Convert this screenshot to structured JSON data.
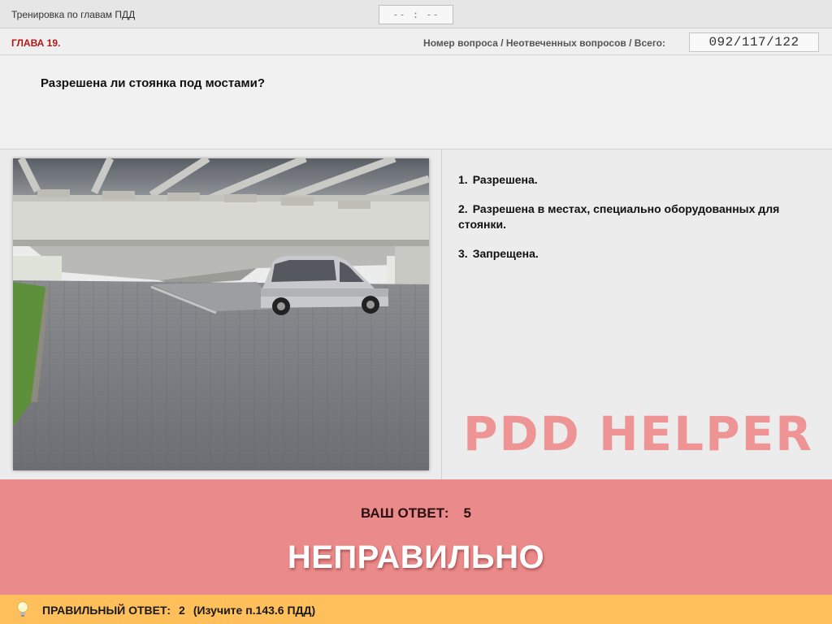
{
  "header": {
    "app_title": "Тренировка по главам ПДД",
    "timer": "-- : --"
  },
  "chapter_bar": {
    "chapter": "ГЛАВА 19.",
    "counter_label": "Номер вопроса / Неотвеченных вопросов / Всего:",
    "counter_value": "092/117/122"
  },
  "question": {
    "text": "Разрешена ли стоянка под мостами?"
  },
  "answers": [
    {
      "number": "1.",
      "text": "Разрешена."
    },
    {
      "number": "2.",
      "text": "Разрешена в местах, специально оборудованных для стоянки."
    },
    {
      "number": "3.",
      "text": "Запрещена."
    }
  ],
  "watermark": "PDD HELPER",
  "result": {
    "your_answer_label": "ВАШ  ОТВЕТ:",
    "your_answer_value": "5",
    "verdict": "НЕПРАВИЛЬНО"
  },
  "correct": {
    "label": "ПРАВИЛЬНЫЙ ОТВЕТ:",
    "value": "2",
    "hint": "(Изучите п.143.6 ПДД)"
  },
  "colors": {
    "result_bg": "#ea8a8a",
    "correct_bg": "#ffbf5a",
    "chapter_red": "#b01818"
  },
  "icons": {
    "hint": "lightbulb-icon"
  }
}
